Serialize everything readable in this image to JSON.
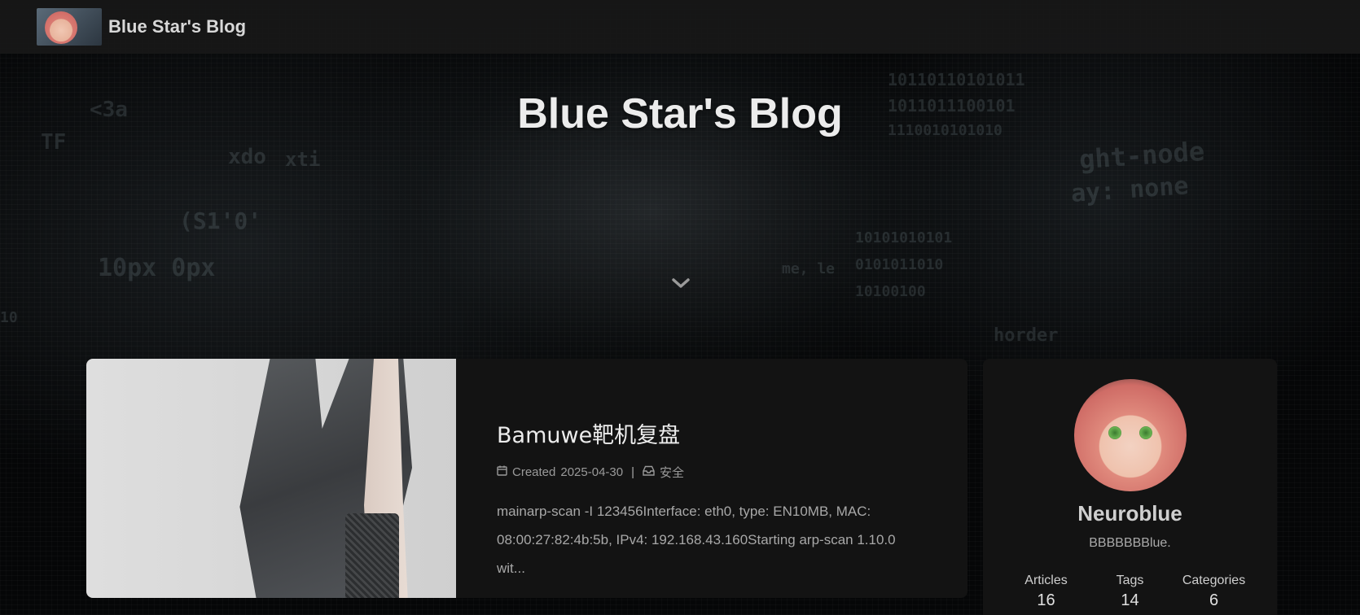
{
  "navbar": {
    "site_name": "Blue Star's Blog",
    "logo_icon": "blog-logo-avatar"
  },
  "hero": {
    "title": "Blue Star's Blog",
    "scroll_icon": "chevron-down-icon"
  },
  "post": {
    "title": "Bamuwe靶机复盘",
    "created_label": "Created",
    "created_date": "2025-04-30",
    "separator": "|",
    "category": "安全",
    "excerpt": "mainarp-scan -I 123456Interface: eth0, type: EN10MB, MAC: 08:00:27:82:4b:5b, IPv4: 192.168.43.160Starting arp-scan 1.10.0 wit..."
  },
  "author": {
    "name": "Neuroblue",
    "description": "BBBBBBBlue.",
    "stats": [
      {
        "label": "Articles",
        "value": "16"
      },
      {
        "label": "Tags",
        "value": "14"
      },
      {
        "label": "Categories",
        "value": "6"
      }
    ]
  },
  "colors": {
    "background": "#000000",
    "card": "#131313",
    "navbar": "#181818"
  }
}
